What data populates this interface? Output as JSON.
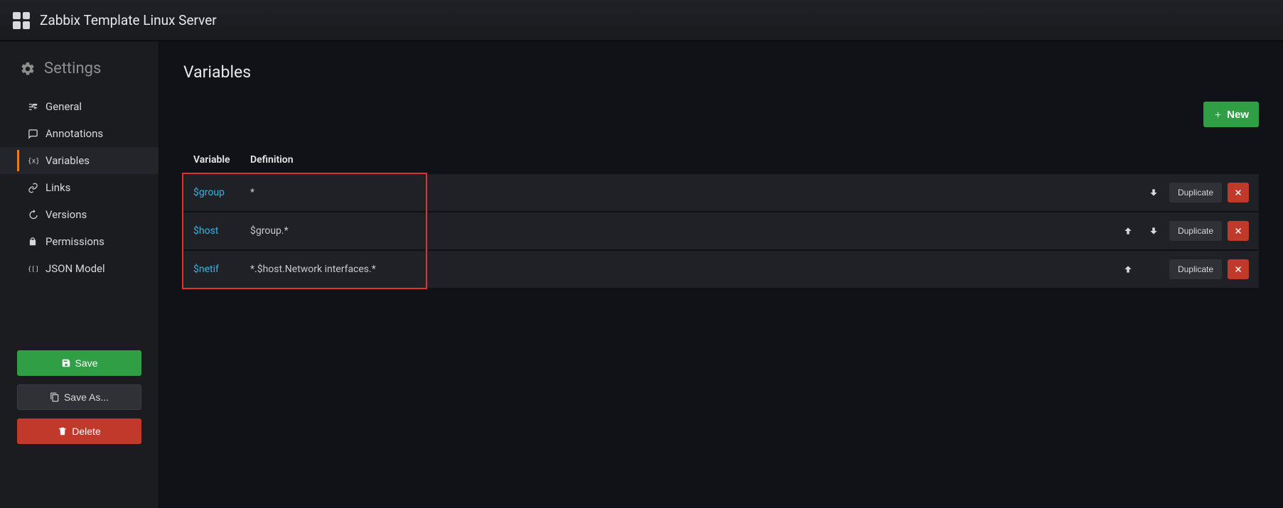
{
  "header": {
    "title": "Zabbix Template Linux Server"
  },
  "sidebar": {
    "heading": "Settings",
    "items": [
      {
        "icon": "sliders-icon",
        "label": "General"
      },
      {
        "icon": "comment-icon",
        "label": "Annotations"
      },
      {
        "icon": "braces-icon",
        "label": "Variables",
        "active": true
      },
      {
        "icon": "link-icon",
        "label": "Links"
      },
      {
        "icon": "history-icon",
        "label": "Versions"
      },
      {
        "icon": "lock-icon",
        "label": "Permissions"
      },
      {
        "icon": "json-icon",
        "label": "JSON Model"
      }
    ],
    "buttons": {
      "save": "Save",
      "save_as": "Save As...",
      "delete": "Delete"
    }
  },
  "page": {
    "title": "Variables",
    "new_label": "New",
    "columns": {
      "variable": "Variable",
      "definition": "Definition"
    },
    "duplicate_label": "Duplicate",
    "rows": [
      {
        "name": "$group",
        "definition": "*",
        "up": false,
        "down": true
      },
      {
        "name": "$host",
        "definition": "$group.*",
        "up": true,
        "down": true
      },
      {
        "name": "$netif",
        "definition": "*.$host.Network interfaces.*",
        "up": true,
        "down": false
      }
    ]
  }
}
